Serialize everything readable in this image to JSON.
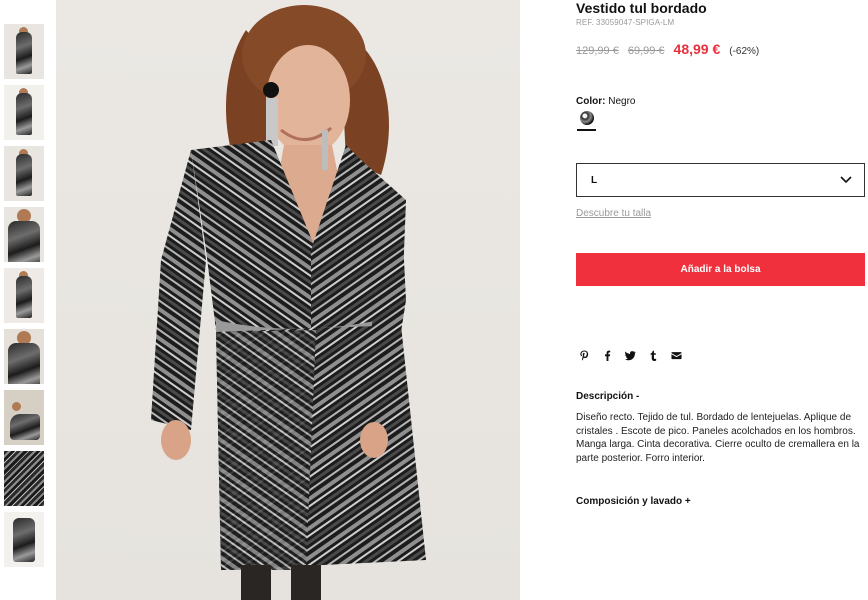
{
  "product": {
    "title": "Vestido tul bordado",
    "ref": "REF. 33059047-SPIGA-LM",
    "price_original": "129,99 €",
    "price_previous": "69,99 €",
    "price_sale": "48,99 €",
    "discount": "(-62%)",
    "color_label": "Color:",
    "color_value": "Negro",
    "selected_size": "L",
    "size_guide": "Descubre tu talla",
    "add_to_bag": "Añadir a la bolsa",
    "description_heading": "Descripción -",
    "description_text": "Diseño recto. Tejido de tul. Bordado de lentejuelas. Aplique de cristales . Escote de pico. Paneles acolchados en los hombros. Manga larga. Cinta decorativa. Cierre oculto de cremallera en la parte posterior. Forro interior.",
    "composition_heading": "Composición y lavado +"
  },
  "colors": {
    "sale": "#e8303d",
    "button": "#f0303c",
    "muted": "#9a9a9a"
  },
  "thumbnails": [
    "full-body-front",
    "full-body-side",
    "full-body-walk",
    "close-up-pose",
    "full-body-turn",
    "close-up-sleeve",
    "seated-pose",
    "fabric-detail",
    "flat-lay"
  ],
  "social_icons": [
    "pinterest-icon",
    "facebook-icon",
    "twitter-icon",
    "tumblr-icon",
    "email-icon"
  ]
}
